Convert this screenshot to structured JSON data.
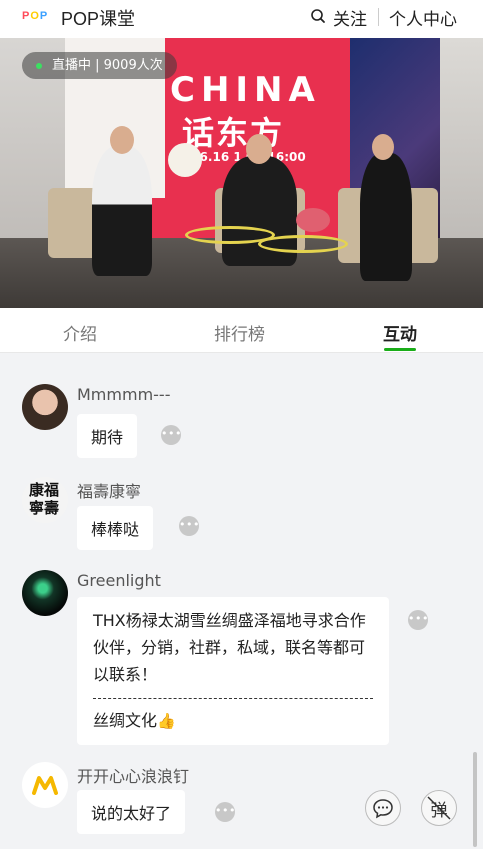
{
  "header": {
    "logo_letters": [
      "P",
      "O",
      "P"
    ],
    "brand": "POP课堂",
    "follow_label": "关注",
    "user_center_label": "个人中心"
  },
  "video": {
    "live_status": "直播中 | 9009人次",
    "poster": {
      "title_en": "CHINA",
      "title_cn": "话东方",
      "time": ".6.16  1  00-16:00"
    }
  },
  "tabs": [
    {
      "label": "介绍",
      "active": false
    },
    {
      "label": "排行榜",
      "active": false
    },
    {
      "label": "互动",
      "active": true
    }
  ],
  "messages": [
    {
      "user": "Mmmmm---",
      "text": "期待"
    },
    {
      "user": "福壽康寧",
      "text": "棒棒哒"
    },
    {
      "user": "Greenlight",
      "text": "THX杨禄太湖雪丝绸盛泽福地寻求合作伙伴，分销，社群，私域，联名等都可以联系！",
      "tag": "丝绸文化"
    },
    {
      "user": "开开心心浪浪钉",
      "text": "说的太好了"
    }
  ],
  "more_glyph": "•••",
  "avatar_text": {
    "fushou": "康福寧壽"
  },
  "danmaku_label": "弹",
  "colors": {
    "logo": [
      "#ff4b5a",
      "#ffcc00",
      "#3ba0ff"
    ],
    "accent": "#1aad19",
    "poster_red": "#e8304f",
    "table_yellow": "#e4d34f"
  }
}
